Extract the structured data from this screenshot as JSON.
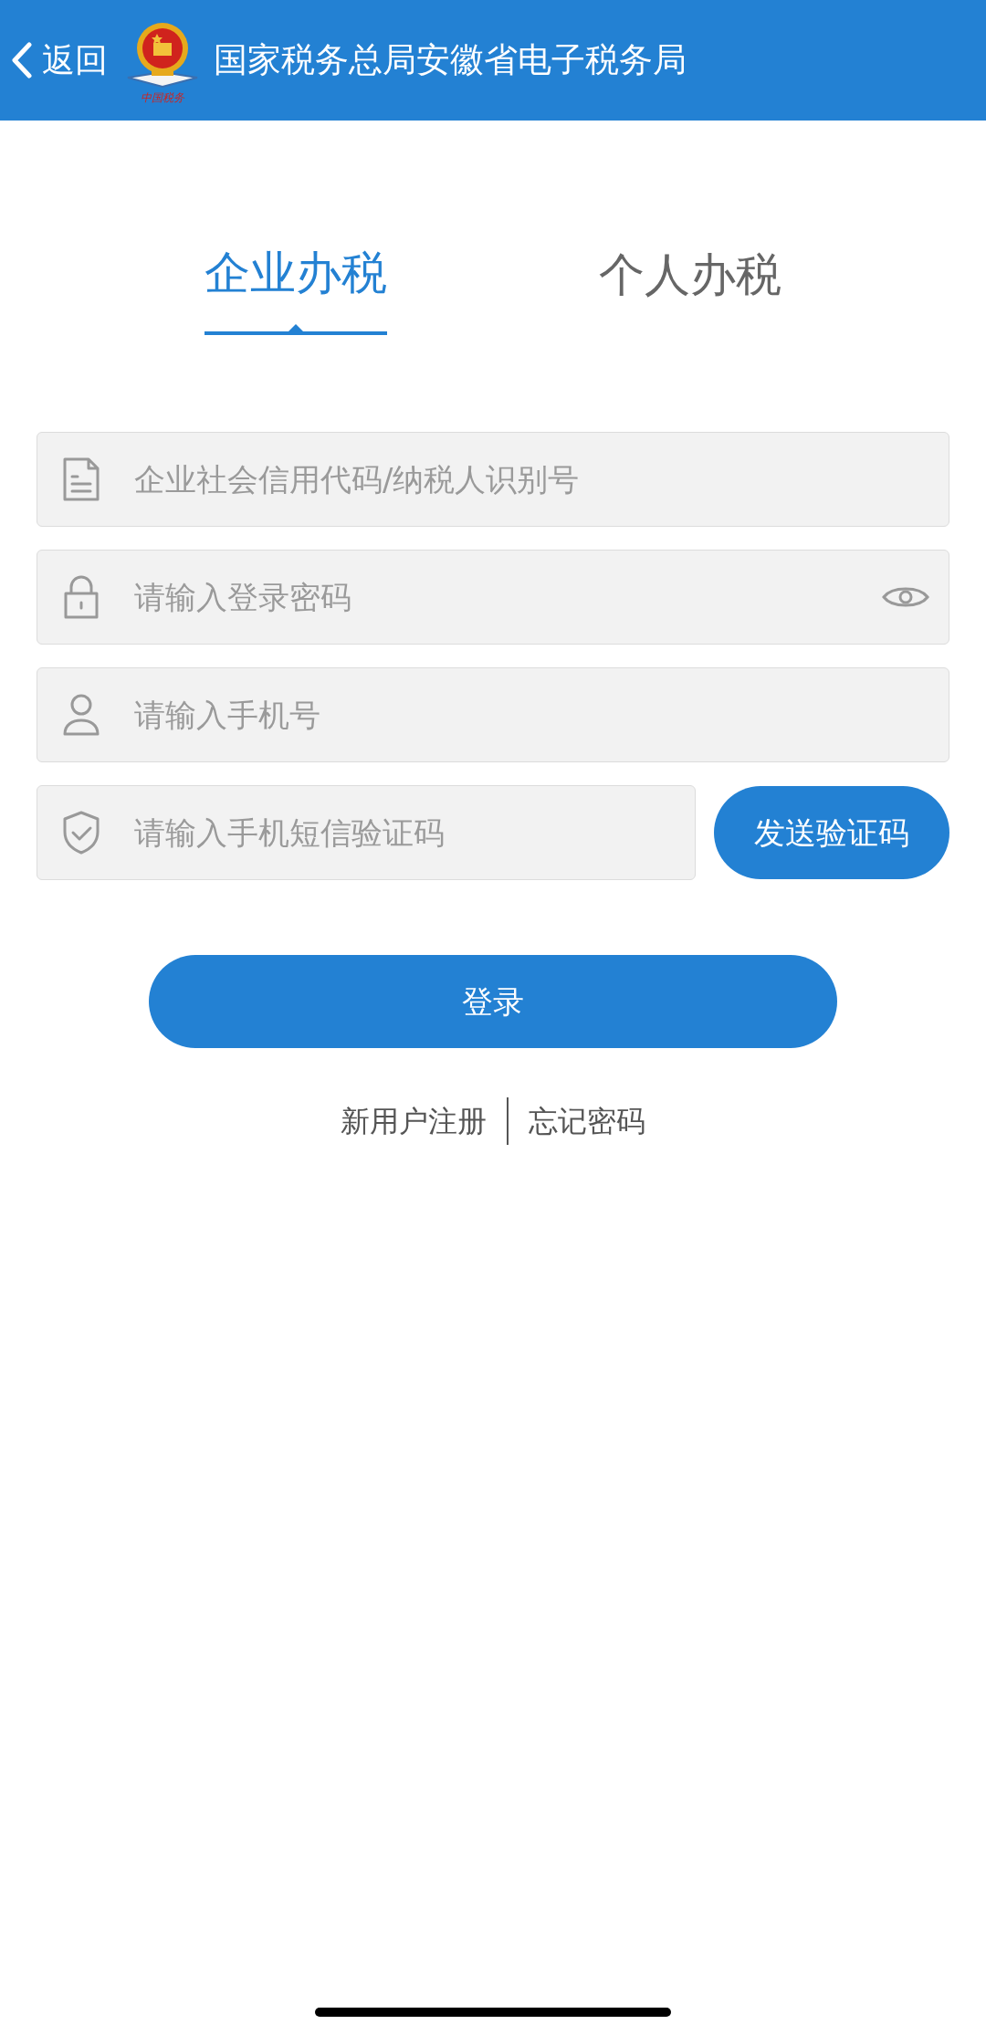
{
  "header": {
    "back_label": "返回",
    "logo_caption": "中国税务",
    "title": "国家税务总局安徽省电子税务局"
  },
  "tabs": [
    {
      "label": "企业办税",
      "selected": true
    },
    {
      "label": "个人办税",
      "selected": false
    }
  ],
  "fields": [
    {
      "kind": "document",
      "placeholder": "企业社会信用代码/纳税人识别号"
    },
    {
      "kind": "password",
      "placeholder": "请输入登录密码"
    },
    {
      "kind": "person",
      "placeholder": "请输入手机号"
    },
    {
      "kind": "sms",
      "placeholder": "请输入手机短信验证码",
      "action": "发送验证码"
    }
  ],
  "login_button": "登录",
  "links": [
    "新用户注册",
    "忘记密码"
  ]
}
